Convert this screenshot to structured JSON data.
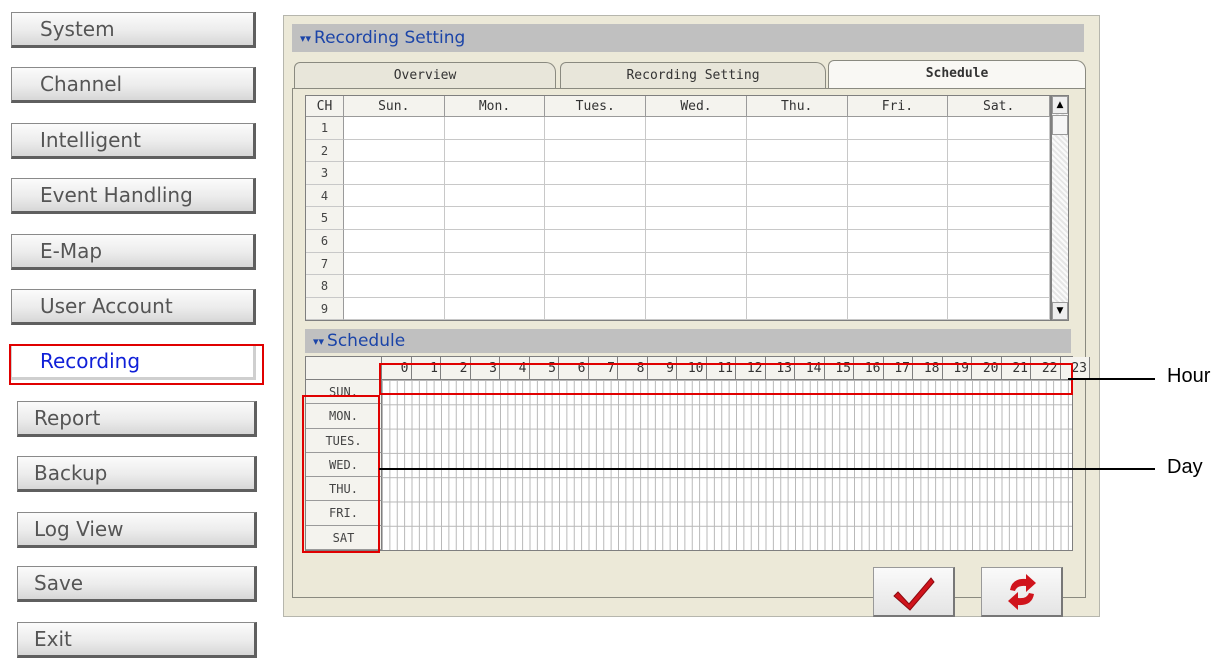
{
  "sidebar": {
    "items": [
      {
        "label": "System"
      },
      {
        "label": "Channel"
      },
      {
        "label": "Intelligent"
      },
      {
        "label": "Event Handling"
      },
      {
        "label": "E-Map"
      },
      {
        "label": "User Account"
      },
      {
        "label": "Recording",
        "active": true
      },
      {
        "label": "Report"
      },
      {
        "label": "Backup"
      },
      {
        "label": "Log View"
      },
      {
        "label": "Save"
      },
      {
        "label": "Exit"
      }
    ]
  },
  "panel": {
    "title": "Recording Setting",
    "tabs": [
      {
        "label": "Overview"
      },
      {
        "label": "Recording Setting"
      },
      {
        "label": "Schedule",
        "selected": true
      }
    ]
  },
  "channel_table": {
    "headers": [
      "CH",
      "Sun.",
      "Mon.",
      "Tues.",
      "Wed.",
      "Thu.",
      "Fri.",
      "Sat."
    ],
    "rows": [
      "1",
      "2",
      "3",
      "4",
      "5",
      "6",
      "7",
      "8",
      "9"
    ]
  },
  "schedule": {
    "title": "Schedule",
    "hours": [
      "0",
      "1",
      "2",
      "3",
      "4",
      "5",
      "6",
      "7",
      "8",
      "9",
      "10",
      "11",
      "12",
      "13",
      "14",
      "15",
      "16",
      "17",
      "18",
      "19",
      "20",
      "21",
      "22",
      "23"
    ],
    "days": [
      "SUN.",
      "MON.",
      "TUES.",
      "WED.",
      "THU.",
      "FRI.",
      "SAT"
    ]
  },
  "actions": {
    "apply_icon": "checkmark-icon",
    "refresh_icon": "refresh-icon"
  },
  "annotations": {
    "hour_label": "Hour",
    "day_label": "Day",
    "highlight_color": "#e00000"
  },
  "colors": {
    "title_text": "#1b44a8",
    "active_nav": "#1020d8",
    "panel_bg": "#ece9d8"
  }
}
